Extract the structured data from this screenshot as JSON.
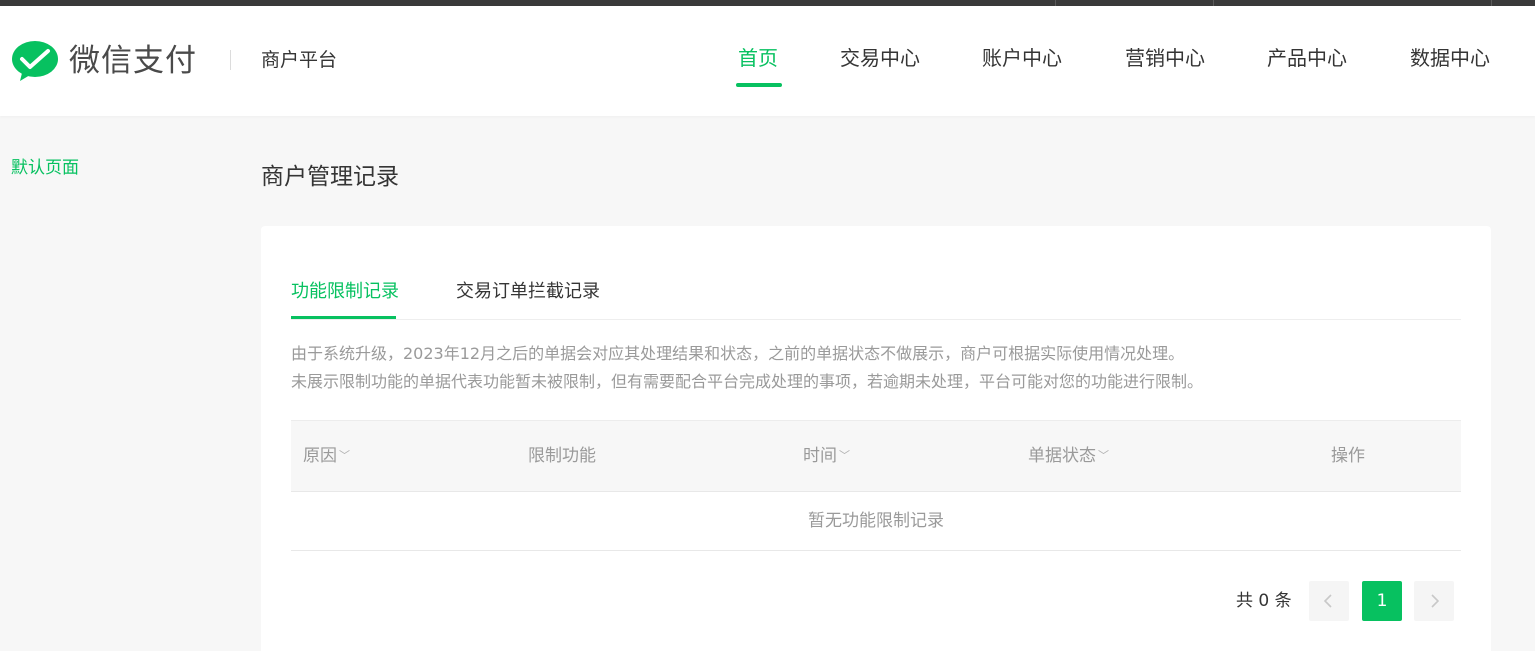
{
  "brand": {
    "logo_text": "微信支付",
    "platform": "商户平台",
    "accent_color": "#07c160"
  },
  "nav": {
    "items": [
      {
        "label": "首页",
        "active": true
      },
      {
        "label": "交易中心",
        "active": false
      },
      {
        "label": "账户中心",
        "active": false
      },
      {
        "label": "营销中心",
        "active": false
      },
      {
        "label": "产品中心",
        "active": false
      },
      {
        "label": "数据中心",
        "active": false
      }
    ]
  },
  "sidebar": {
    "items": [
      {
        "label": "默认页面",
        "active": true
      }
    ]
  },
  "main": {
    "title": "商户管理记录",
    "tabs": [
      {
        "label": "功能限制记录",
        "active": true
      },
      {
        "label": "交易订单拦截记录",
        "active": false
      }
    ],
    "notice": [
      "由于系统升级，2023年12月之后的单据会对应其处理结果和状态，之前的单据状态不做展示，商户可根据实际使用情况处理。",
      "未展示限制功能的单据代表功能暂未被限制，但有需要配合平台完成处理的事项，若逾期未处理，平台可能对您的功能进行限制。"
    ],
    "table": {
      "columns": [
        {
          "label": "原因",
          "sortable": true
        },
        {
          "label": "限制功能",
          "sortable": false
        },
        {
          "label": "时间",
          "sortable": true
        },
        {
          "label": "单据状态",
          "sortable": true
        },
        {
          "label": "操作",
          "sortable": false
        }
      ],
      "empty_text": "暂无功能限制记录"
    },
    "pagination": {
      "total_label": "共 0 条",
      "current_page": "1",
      "prev_icon": "chevron-left-icon",
      "next_icon": "chevron-right-icon"
    }
  }
}
